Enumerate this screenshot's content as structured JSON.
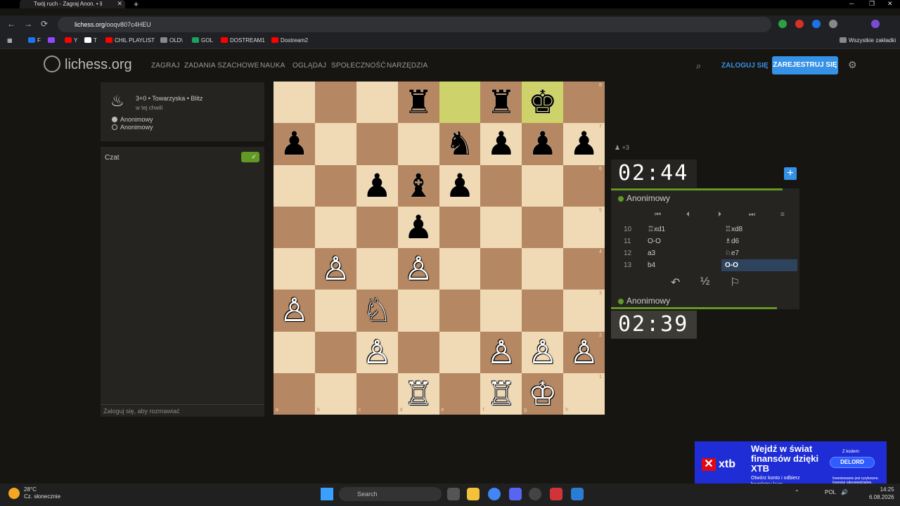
{
  "browser": {
    "tab_title": "Twój ruch - Zagraj Anon. • li",
    "url_host": "lichess.org",
    "url_path": "/ooqv807c4HEU",
    "bookmarks": [
      "F",
      "Y",
      "T",
      "CHIL PLAYLIST",
      "OLD\\",
      "GOL",
      "DOSTREAM1",
      "Dostream2"
    ],
    "all_bookmarks": "Wszystkie zakładki"
  },
  "site": {
    "logo": "lichess.org",
    "nav": [
      "ZAGRAJ",
      "ZADANIA SZACHOWE",
      "NAUKA",
      "OGLĄDAJ",
      "SPOŁECZNOŚĆ",
      "NARZĘDZIA"
    ],
    "login": "ZALOGUJ SIĘ",
    "register": "ZAREJESTRUJ SIĘ"
  },
  "game_info": {
    "title": "3+0 • Towarzyska • Blitz",
    "subtitle": "w tej chwili",
    "white_player": "Anonimowy",
    "black_player": "Anonimowy"
  },
  "chat": {
    "title": "Czat",
    "placeholder": "Zaloguj się, aby rozmawiać"
  },
  "board": {
    "files": [
      "a",
      "b",
      "c",
      "d",
      "e",
      "f",
      "g",
      "h"
    ],
    "ranks": [
      "8",
      "7",
      "6",
      "5",
      "4",
      "3",
      "2",
      "1"
    ],
    "highlight": [
      "e8",
      "g8"
    ],
    "pieces": {
      "d8": "♜",
      "f8": "♜",
      "g8": "♚",
      "a7": "♟",
      "e7": "♞",
      "f7": "♟",
      "g7": "♟",
      "h7": "♟",
      "c6": "♟",
      "d6": "♝",
      "e6": "♟",
      "d5": "♟",
      "b4": "♙",
      "d4": "♙",
      "a3": "♙",
      "c3": "♘",
      "c2": "♙",
      "f2": "♙",
      "g2": "♙",
      "h2": "♙",
      "d1": "♖",
      "f1": "♖",
      "g1": "♔"
    },
    "colors": {
      "d8": "b",
      "f8": "b",
      "g8": "b",
      "a7": "b",
      "e7": "b",
      "f7": "b",
      "g7": "b",
      "h7": "b",
      "c6": "b",
      "d6": "b",
      "e6": "b",
      "d5": "b",
      "b4": "w",
      "d4": "w",
      "a3": "w",
      "c3": "w",
      "c2": "w",
      "f2": "w",
      "g2": "w",
      "h2": "w",
      "d1": "w",
      "f1": "w",
      "g1": "w"
    }
  },
  "clocks": {
    "material": "+3",
    "top_time": "02:44",
    "bottom_time": "02:39",
    "top_player": "Anonimowy",
    "bottom_player": "Anonimowy",
    "top_remaining_fraction": 0.91,
    "bottom_remaining_fraction": 0.88
  },
  "moves": [
    {
      "num": "10",
      "white": "♖xd1",
      "black": "♖xd8"
    },
    {
      "num": "11",
      "white": "O-O",
      "black": "♗d6"
    },
    {
      "num": "12",
      "white": "a3",
      "black": "♘e7"
    },
    {
      "num": "13",
      "white": "b4",
      "black": "O-O"
    }
  ],
  "actions": {
    "takeback": "↶",
    "draw": "½",
    "resign": "⚐"
  },
  "ad": {
    "logo": "xtb",
    "headline": "Wejdź w świat finansów dzięki XTB",
    "sub": "Otwórz konto i odbierz bezpłatny kurs",
    "code_label": "Z kodem:",
    "code": "DELORD",
    "fine": "Inwestowanie jest ryzykowne. Inwestuj odpowiedzialnie."
  },
  "taskbar": {
    "temp": "28°C",
    "weather": "Cz. słonecznie",
    "search": "Search",
    "lang": "POL",
    "time": "14:25",
    "date": "6.08.2026"
  }
}
